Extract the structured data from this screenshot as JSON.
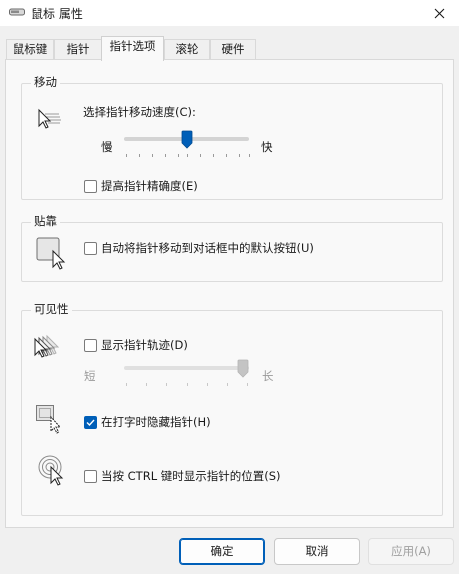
{
  "window": {
    "title": "鼠标 属性"
  },
  "tabs": [
    {
      "label": "鼠标键"
    },
    {
      "label": "指针"
    },
    {
      "label": "指针选项"
    },
    {
      "label": "滚轮"
    },
    {
      "label": "硬件"
    }
  ],
  "active_tab": "指针选项",
  "motion": {
    "group_label": "移动",
    "speed_label": "选择指针移动速度(C):",
    "slow_label": "慢",
    "fast_label": "快",
    "speed_level": 0.5,
    "enhance_precision": {
      "label": "提高指针精确度(E)",
      "checked": false
    }
  },
  "snap_to": {
    "group_label": "贴靠",
    "auto_move": {
      "label": "自动将指针移动到对话框中的默认按钮(U)",
      "checked": false
    }
  },
  "visibility": {
    "group_label": "可见性",
    "pointer_trails": {
      "label": "显示指针轨迹(D)",
      "checked": false
    },
    "short_label": "短",
    "long_label": "长",
    "trail_length_level": 1.0,
    "hide_while_typing": {
      "label": "在打字时隐藏指针(H)",
      "checked": true
    },
    "show_location_ctrl": {
      "label": "当按 CTRL 键时显示指针的位置(S)",
      "checked": false
    }
  },
  "buttons": {
    "ok": "确定",
    "cancel": "取消",
    "apply": "应用(A)"
  },
  "colors": {
    "accent": "#005fb8",
    "window_bg": "#f0f0f0",
    "panel_bg": "#f9f9f9",
    "disabled_text": "#9a9a9a"
  }
}
